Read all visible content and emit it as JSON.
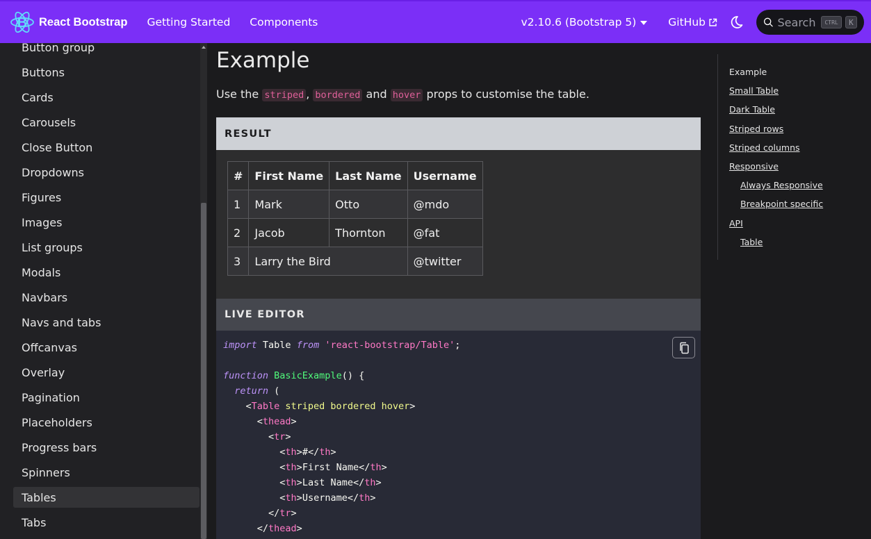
{
  "navbar": {
    "brand": "React Bootstrap",
    "links": [
      "Getting Started",
      "Components"
    ],
    "version": "v2.10.6 (Bootstrap 5)",
    "github": "GitHub",
    "search_placeholder": "Search",
    "kbd_ctrl": "CTRL",
    "kbd_k": "K",
    "accent": "#7b2ff7"
  },
  "sidebar": {
    "items": [
      {
        "label": "Button group"
      },
      {
        "label": "Buttons"
      },
      {
        "label": "Cards"
      },
      {
        "label": "Carousels"
      },
      {
        "label": "Close Button"
      },
      {
        "label": "Dropdowns"
      },
      {
        "label": "Figures"
      },
      {
        "label": "Images"
      },
      {
        "label": "List groups"
      },
      {
        "label": "Modals"
      },
      {
        "label": "Navbars"
      },
      {
        "label": "Navs and tabs"
      },
      {
        "label": "Offcanvas"
      },
      {
        "label": "Overlay"
      },
      {
        "label": "Pagination"
      },
      {
        "label": "Placeholders"
      },
      {
        "label": "Progress bars"
      },
      {
        "label": "Spinners"
      },
      {
        "label": "Tables",
        "active": true
      },
      {
        "label": "Tabs"
      }
    ]
  },
  "main": {
    "heading": "Example",
    "desc_pre": "Use the ",
    "code1": "striped",
    "desc_sep1": ", ",
    "code2": "bordered",
    "desc_sep2": " and ",
    "code3": "hover",
    "desc_post": " props to customise the table.",
    "result_label": "RESULT",
    "live_editor_label": "LIVE EDITOR",
    "table": {
      "headers": [
        "#",
        "First Name",
        "Last Name",
        "Username"
      ],
      "rows": [
        [
          "1",
          "Mark",
          "Otto",
          "@mdo"
        ],
        [
          "2",
          "Jacob",
          "Thornton",
          "@fat"
        ],
        [
          "3",
          "Larry the Bird",
          "",
          "@twitter"
        ]
      ]
    },
    "code": {
      "l1_import": "import",
      "l1_table": " Table ",
      "l1_from": "from",
      "l1_str": " 'react-bootstrap/Table'",
      "l1_end": ";",
      "l3_function": "function",
      "l3_name": " BasicExample",
      "l3_rest": "() {",
      "l4_return": "  return",
      "l4_rest": " (",
      "l5_open": "    <",
      "l5_tag": "Table",
      "l5_attrs": " striped bordered hover",
      "l5_close": ">",
      "l6_open": "      <",
      "l6_tag": "thead",
      "l6_close": ">",
      "l7_open": "        <",
      "l7_tag": "tr",
      "l7_close": ">",
      "th_hash": "#",
      "th_first": "First Name",
      "th_last": "Last Name",
      "th_user": "Username",
      "th_tag": "th",
      "l12_tag": "tr",
      "l13_tag": "thead"
    }
  },
  "toc": {
    "items": [
      {
        "label": "Example",
        "current": true
      },
      {
        "label": "Small Table"
      },
      {
        "label": "Dark Table"
      },
      {
        "label": "Striped rows"
      },
      {
        "label": "Striped columns"
      },
      {
        "label": "Responsive"
      },
      {
        "label": "Always Responsive",
        "sub": true
      },
      {
        "label": "Breakpoint specific",
        "sub": true
      },
      {
        "label": "API"
      },
      {
        "label": "Table",
        "sub": true
      }
    ]
  }
}
